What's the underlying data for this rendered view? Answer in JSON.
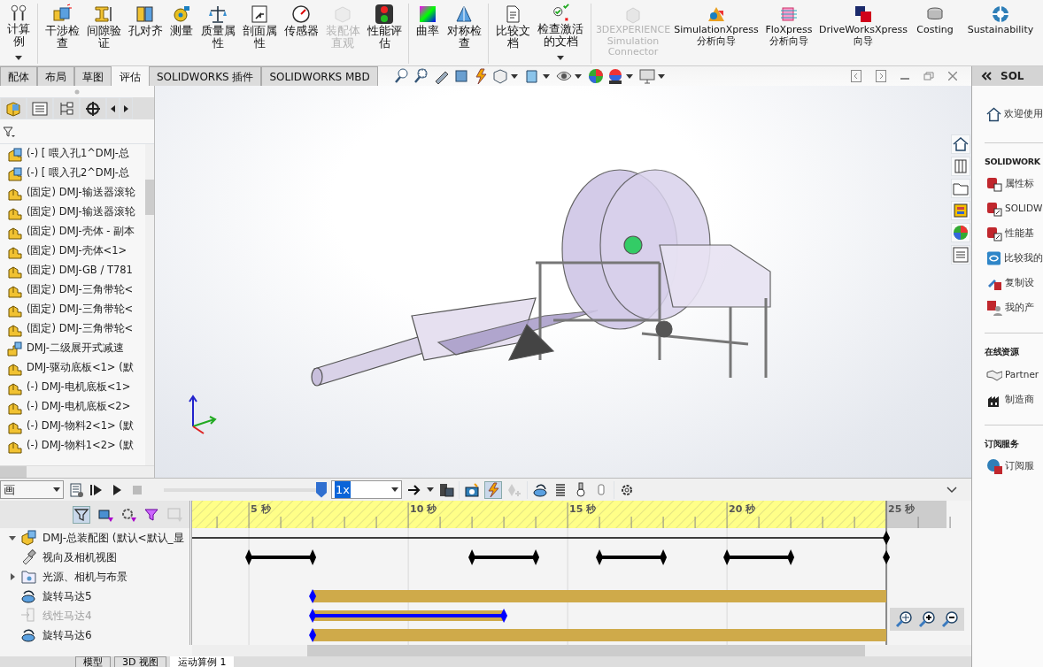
{
  "ribbon": {
    "groups": [
      [
        {
          "label": "计算例",
          "disabled": false,
          "has_menu": true
        }
      ],
      [
        {
          "label": "干涉检查",
          "disabled": false,
          "has_menu": false
        },
        {
          "label": "间隙验证",
          "disabled": false,
          "has_menu": false
        },
        {
          "label": "孔对齐",
          "disabled": false,
          "has_menu": false
        },
        {
          "label": "测量",
          "disabled": false,
          "has_menu": false
        },
        {
          "label": "质量属性",
          "disabled": false,
          "has_menu": false
        },
        {
          "label": "剖面属性",
          "disabled": false,
          "has_menu": false
        },
        {
          "label": "传感器",
          "disabled": false,
          "has_menu": false
        },
        {
          "label": "装配体直观",
          "disabled": true,
          "has_menu": false
        },
        {
          "label": "性能评估",
          "disabled": false,
          "has_menu": false
        }
      ],
      [
        {
          "label": "曲率",
          "disabled": false,
          "has_menu": false
        },
        {
          "label": "对称检查",
          "disabled": false,
          "has_menu": false
        }
      ],
      [
        {
          "label": "比较文档",
          "disabled": false,
          "has_menu": false
        },
        {
          "label": "检查激活的文档",
          "disabled": false,
          "has_menu": true
        }
      ],
      [
        {
          "label": "3DEXPERIENCE Simulation Connector",
          "disabled": true,
          "has_menu": false
        },
        {
          "label": "SimulationXpress 分析向导",
          "disabled": false,
          "has_menu": false
        },
        {
          "label": "FloXpress 分析向导",
          "disabled": false,
          "has_menu": false
        },
        {
          "label": "DriveWorksXpress 向导",
          "disabled": false,
          "has_menu": false
        },
        {
          "label": "Costing",
          "disabled": false,
          "has_menu": false
        },
        {
          "label": "Sustainability",
          "disabled": false,
          "has_menu": false
        }
      ]
    ]
  },
  "command_tabs": [
    {
      "label": "配体",
      "selected": false
    },
    {
      "label": "布局",
      "selected": false
    },
    {
      "label": "草图",
      "selected": false
    },
    {
      "label": "评估",
      "selected": true
    },
    {
      "label": "SOLIDWORKS 插件",
      "selected": false
    },
    {
      "label": "SOLIDWORKS MBD",
      "selected": false
    }
  ],
  "feature_tree": {
    "items": [
      {
        "label": "(-) [ 喂入孔1^DMJ-总",
        "kind": "hole"
      },
      {
        "label": "(-) [ 喂入孔2^DMJ-总",
        "kind": "hole"
      },
      {
        "label": "(固定) DMJ-输送器滚轮",
        "kind": "part"
      },
      {
        "label": "(固定) DMJ-输送器滚轮",
        "kind": "part"
      },
      {
        "label": "(固定) DMJ-壳体 - 副本",
        "kind": "part"
      },
      {
        "label": "(固定) DMJ-壳体<1>",
        "kind": "part"
      },
      {
        "label": "(固定) DMJ-GB / T781",
        "kind": "part"
      },
      {
        "label": "(固定) DMJ-三角带轮<",
        "kind": "part"
      },
      {
        "label": "(固定) DMJ-三角带轮<",
        "kind": "part"
      },
      {
        "label": "(固定) DMJ-三角带轮<",
        "kind": "part"
      },
      {
        "label": "DMJ-二级展开式减速",
        "kind": "assembly"
      },
      {
        "label": "DMJ-驱动底板<1> (默",
        "kind": "part"
      },
      {
        "label": "(-) DMJ-电机底板<1>",
        "kind": "part"
      },
      {
        "label": "(-) DMJ-电机底板<2>",
        "kind": "part"
      },
      {
        "label": "(-) DMJ-物料2<1> (默",
        "kind": "part"
      },
      {
        "label": "(-) DMJ-物料1<2> (默",
        "kind": "part"
      }
    ]
  },
  "task_pane": {
    "header": "SOL",
    "welcome": "欢迎使用",
    "sections": [
      {
        "title": "SOLIDWORK",
        "items": [
          {
            "label": "属性标",
            "kind": "sw-doc"
          },
          {
            "label": "SOLIDW",
            "kind": "sw-fx"
          },
          {
            "label": "性能基",
            "kind": "sw-fx"
          },
          {
            "label": "比较我的",
            "kind": "compare"
          },
          {
            "label": "复制设",
            "kind": "copy"
          },
          {
            "label": "我的产",
            "kind": "product"
          }
        ]
      },
      {
        "title": "在线资源",
        "items": [
          {
            "label": "Partner",
            "kind": "handshake"
          },
          {
            "label": "制造商",
            "kind": "factory"
          }
        ]
      },
      {
        "title": "订阅服务",
        "items": [
          {
            "label": "订阅服",
            "kind": "globe"
          }
        ]
      }
    ]
  },
  "motion_study": {
    "study_type": "画",
    "playback": {
      "level": 1
    },
    "speed": "1x",
    "auto_key_selected": true,
    "tree": [
      {
        "label": "DMJ-总装配图  (默认<默认_显",
        "kind": "assembly",
        "expanded": true,
        "disabled": false
      },
      {
        "label": "视向及相机视图",
        "kind": "camera",
        "disabled": false
      },
      {
        "label": "光源、相机与布景",
        "kind": "lights",
        "expanded": false,
        "disabled": false
      },
      {
        "label": "旋转马达5",
        "kind": "rotary",
        "disabled": false
      },
      {
        "label": "线性马达4",
        "kind": "linear",
        "disabled": true
      },
      {
        "label": "旋转马达6",
        "kind": "rotary",
        "disabled": false
      }
    ],
    "timeline": {
      "ruler": [
        "5 秒",
        "10 秒",
        "15 秒",
        "20 秒",
        "25 秒"
      ]
    }
  },
  "bottom_tabs": [
    {
      "label": "模型",
      "selected": false
    },
    {
      "label": "3D 视图",
      "selected": false
    },
    {
      "label": "运动算例 1",
      "selected": true
    }
  ]
}
